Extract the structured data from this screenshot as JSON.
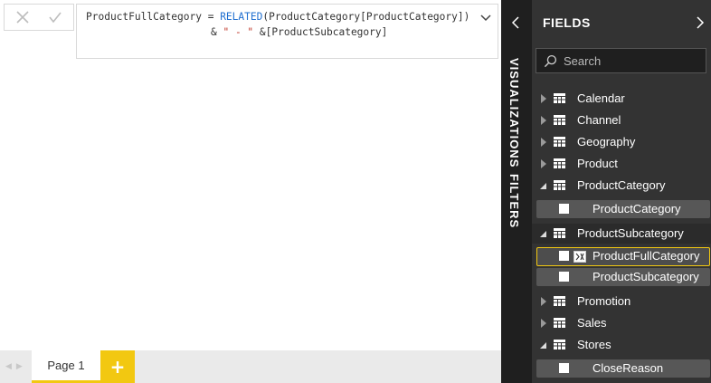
{
  "formula_bar": {
    "line1_prefix": "ProductFullCategory = ",
    "line1_func": "RELATED",
    "line1_arg": "(ProductCategory[ProductCategory])",
    "line2_amp1": "& ",
    "line2_str": "\" - \"",
    "line2_rest": " &[ProductSubcategory]"
  },
  "pages": {
    "tabs": [
      {
        "label": "Page 1",
        "active": true
      }
    ],
    "add_label": "+"
  },
  "rail": {
    "visualizations_label": "VISUALIZATIONS",
    "filters_label": "FILTERS"
  },
  "fields_pane": {
    "title": "FIELDS",
    "search_placeholder": "Search",
    "tables": [
      {
        "name": "Calendar",
        "expanded": false
      },
      {
        "name": "Channel",
        "expanded": false
      },
      {
        "name": "Geography",
        "expanded": false
      },
      {
        "name": "Product",
        "expanded": false
      },
      {
        "name": "ProductCategory",
        "expanded": true,
        "fields": [
          "ProductCategory"
        ]
      },
      {
        "name": "ProductSubcategory",
        "expanded": true,
        "fields": [
          "ProductFullCategory",
          "ProductSubcategory"
        ]
      },
      {
        "name": "Promotion",
        "expanded": false
      },
      {
        "name": "Sales",
        "expanded": false
      },
      {
        "name": "Stores",
        "expanded": true,
        "fields": [
          "CloseReason"
        ]
      }
    ]
  },
  "colors": {
    "accent": "#f2c811",
    "pane_bg": "#333333",
    "rail_bg": "#1f1f1f"
  },
  "icons": [
    "close-icon",
    "check-icon",
    "chevron-down-icon",
    "chevron-left-icon",
    "chevron-right-icon",
    "search-icon",
    "table-icon",
    "calculated-column-icon"
  ]
}
